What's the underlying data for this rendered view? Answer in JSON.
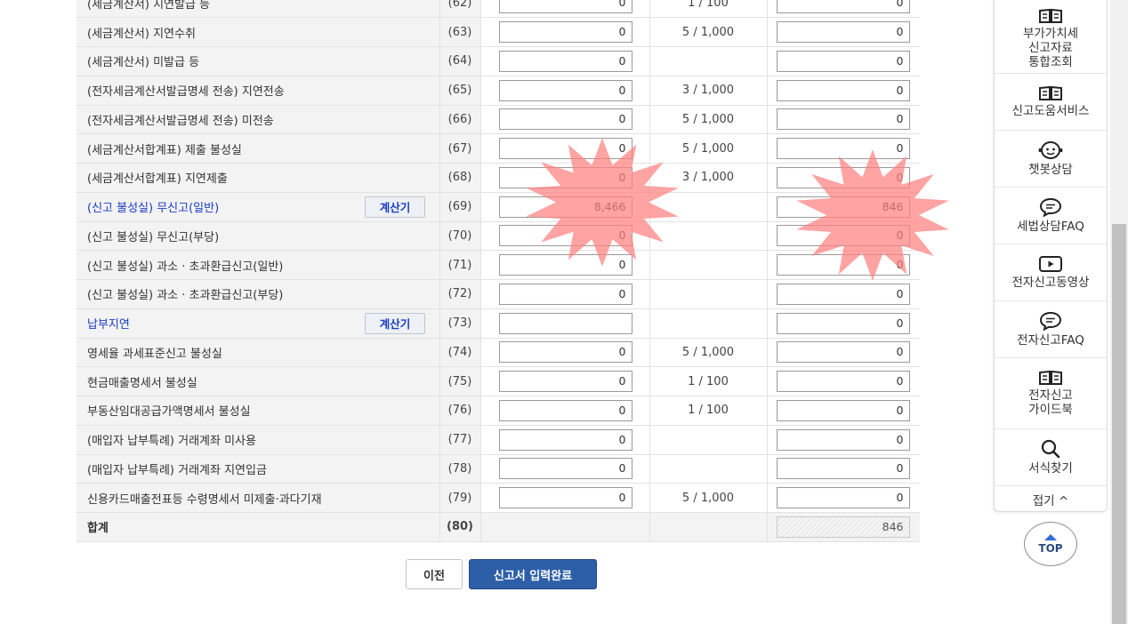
{
  "rows": [
    {
      "label": "(세금계산서) 지연발급 등",
      "num": "(62)",
      "amount": "0",
      "rate": "1 / 100",
      "result": "0"
    },
    {
      "label": "(세금계산서) 지연수취",
      "num": "(63)",
      "amount": "0",
      "rate": "5 / 1,000",
      "result": "0"
    },
    {
      "label": "(세금계산서) 미발급 등",
      "num": "(64)",
      "amount": "0",
      "rate": "",
      "result": "0"
    },
    {
      "label": "(전자세금계산서발급명세 전송) 지연전송",
      "num": "(65)",
      "amount": "0",
      "rate": "3 / 1,000",
      "result": "0"
    },
    {
      "label": "(전자세금계산서발급명세 전송) 미전송",
      "num": "(66)",
      "amount": "0",
      "rate": "5 / 1,000",
      "result": "0"
    },
    {
      "label": "(세금계산서합계표) 제출 불성실",
      "num": "(67)",
      "amount": "0",
      "rate": "5 / 1,000",
      "result": "0"
    },
    {
      "label": "(세금계산서합계표) 지연제출",
      "num": "(68)",
      "amount": "0",
      "rate": "3 / 1,000",
      "result": "0"
    },
    {
      "label": "(신고 불성실) 무신고(일반)",
      "num": "(69)",
      "amount": "8,466",
      "rate": "",
      "result": "846",
      "link": true,
      "calc": "계산기"
    },
    {
      "label": "(신고 불성실) 무신고(부당)",
      "num": "(70)",
      "amount": "0",
      "rate": "",
      "result": "0"
    },
    {
      "label": "(신고 불성실) 과소 · 초과환급신고(일반)",
      "num": "(71)",
      "amount": "0",
      "rate": "",
      "result": "0"
    },
    {
      "label": "(신고 불성실) 과소 · 초과환급신고(부당)",
      "num": "(72)",
      "amount": "0",
      "rate": "",
      "result": "0"
    },
    {
      "label": "납부지연",
      "num": "(73)",
      "amount": "",
      "rate": "",
      "result": "0",
      "link": true,
      "calc": "계산기"
    },
    {
      "label": "영세율 과세표준신고 불성실",
      "num": "(74)",
      "amount": "0",
      "rate": "5 / 1,000",
      "result": "0"
    },
    {
      "label": "현금매출명세서 불성실",
      "num": "(75)",
      "amount": "0",
      "rate": "1 / 100",
      "result": "0"
    },
    {
      "label": "부동산임대공급가액명세서 불성실",
      "num": "(76)",
      "amount": "0",
      "rate": "1 / 100",
      "result": "0"
    },
    {
      "label": "(매입자 납부특례) 거래계좌 미사용",
      "num": "(77)",
      "amount": "0",
      "rate": "",
      "result": "0"
    },
    {
      "label": "(매입자 납부특례) 거래계좌 지연입금",
      "num": "(78)",
      "amount": "0",
      "rate": "",
      "result": "0"
    },
    {
      "label": "신용카드매출전표등 수령명세서 미제출·과다기재",
      "num": "(79)",
      "amount": "0",
      "rate": "5 / 1,000",
      "result": "0"
    }
  ],
  "total": {
    "label": "합계",
    "num": "(80)",
    "value": "846"
  },
  "buttons": {
    "prev": "이전",
    "submit": "신고서 입력완료"
  },
  "sidebar": {
    "items": [
      {
        "label": "부가가치세\n신고자료\n통합조회",
        "icon": "book-icon"
      },
      {
        "label": "신고도움서비스",
        "icon": "book-icon"
      },
      {
        "label": "챗봇상담",
        "icon": "chatbot-icon"
      },
      {
        "label": "세법상담FAQ",
        "icon": "speech-bubble-icon"
      },
      {
        "label": "전자신고동영상",
        "icon": "video-play-icon"
      },
      {
        "label": "전자신고FAQ",
        "icon": "speech-bubble-icon"
      },
      {
        "label": "전자신고\n가이드북",
        "icon": "book-icon"
      },
      {
        "label": "서식찾기",
        "icon": "search-icon"
      }
    ],
    "collapse": "접기 ^"
  },
  "top_button": "TOP",
  "colors": {
    "link": "#1a3dc4",
    "primary_button": "#2d5fa8",
    "highlight_stamp": "#ff8080"
  }
}
